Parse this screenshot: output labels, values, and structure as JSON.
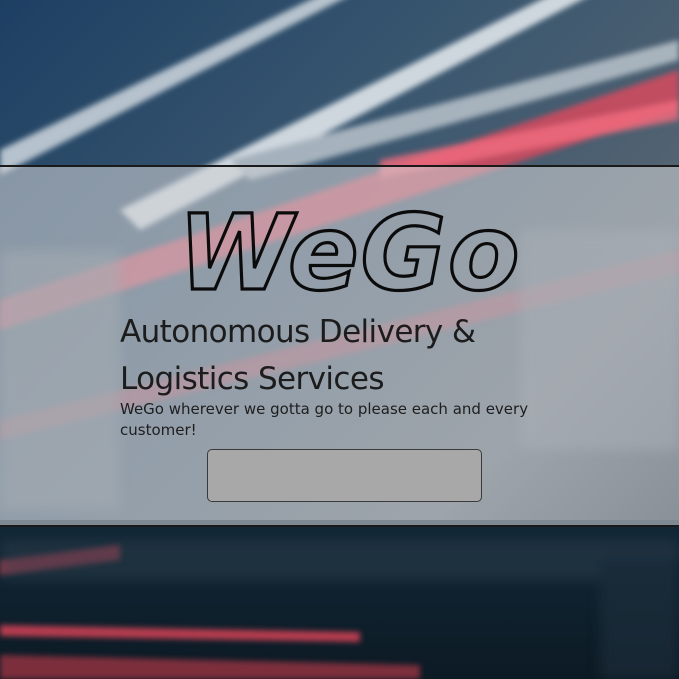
{
  "hero": {
    "logo_text": "WeGo",
    "headline": "Autonomous Delivery & Logistics Services",
    "tagline": "WeGo wherever we gotta go to please each and every customer!",
    "cta_label": ""
  },
  "colors": {
    "overlay": "#ced1d4",
    "button_fill": "#a9a8a8",
    "text": "#1c1c1c",
    "background_dark": "#0f2433",
    "light_streak_red": "#e8475c"
  },
  "icons": {
    "background": "light-trails-background"
  }
}
